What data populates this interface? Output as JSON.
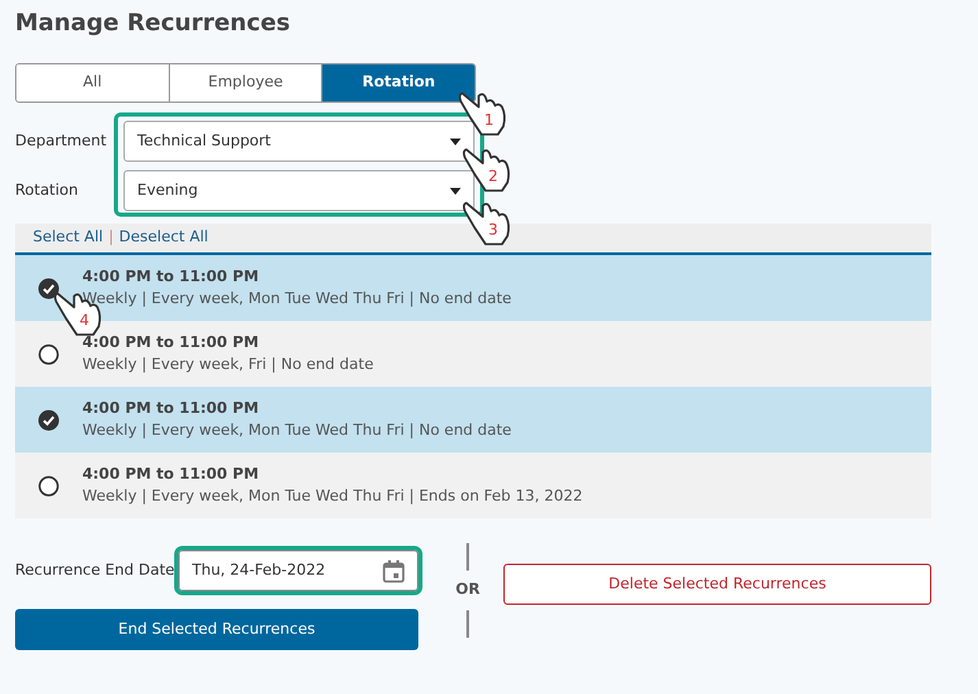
{
  "title": "Manage Recurrences",
  "tabs": [
    {
      "label": "All",
      "selected": false
    },
    {
      "label": "Employee",
      "selected": false
    },
    {
      "label": "Rotation",
      "selected": true
    }
  ],
  "filters": [
    {
      "label": "Department",
      "value": "Technical Support"
    },
    {
      "label": "Rotation",
      "value": "Evening"
    }
  ],
  "list_actions": {
    "select_all": "Select All",
    "separator": "|",
    "deselect_all": "Deselect All"
  },
  "recurrences": [
    {
      "time": "4:00 PM to 11:00 PM",
      "detail": "Weekly | Every week, Mon Tue Wed Thu Fri | No end date",
      "selected": true
    },
    {
      "time": "4:00 PM to 11:00 PM",
      "detail": "Weekly | Every week, Fri | No end date",
      "selected": false
    },
    {
      "time": "4:00 PM to 11:00 PM",
      "detail": "Weekly | Every week, Mon Tue Wed Thu Fri | No end date",
      "selected": true
    },
    {
      "time": "4:00 PM to 11:00 PM",
      "detail": "Weekly | Every week, Mon Tue Wed Thu Fri | Ends on Feb 13, 2022",
      "selected": false
    }
  ],
  "end_date": {
    "label": "Recurrence End Date",
    "value": "Thu, 24-Feb-2022"
  },
  "end_button": "End Selected Recurrences",
  "or_label": "OR",
  "delete_button": "Delete Selected Recurrences",
  "annotations": [
    {
      "label": "1"
    },
    {
      "label": "2"
    },
    {
      "label": "3"
    },
    {
      "label": "4"
    }
  ]
}
